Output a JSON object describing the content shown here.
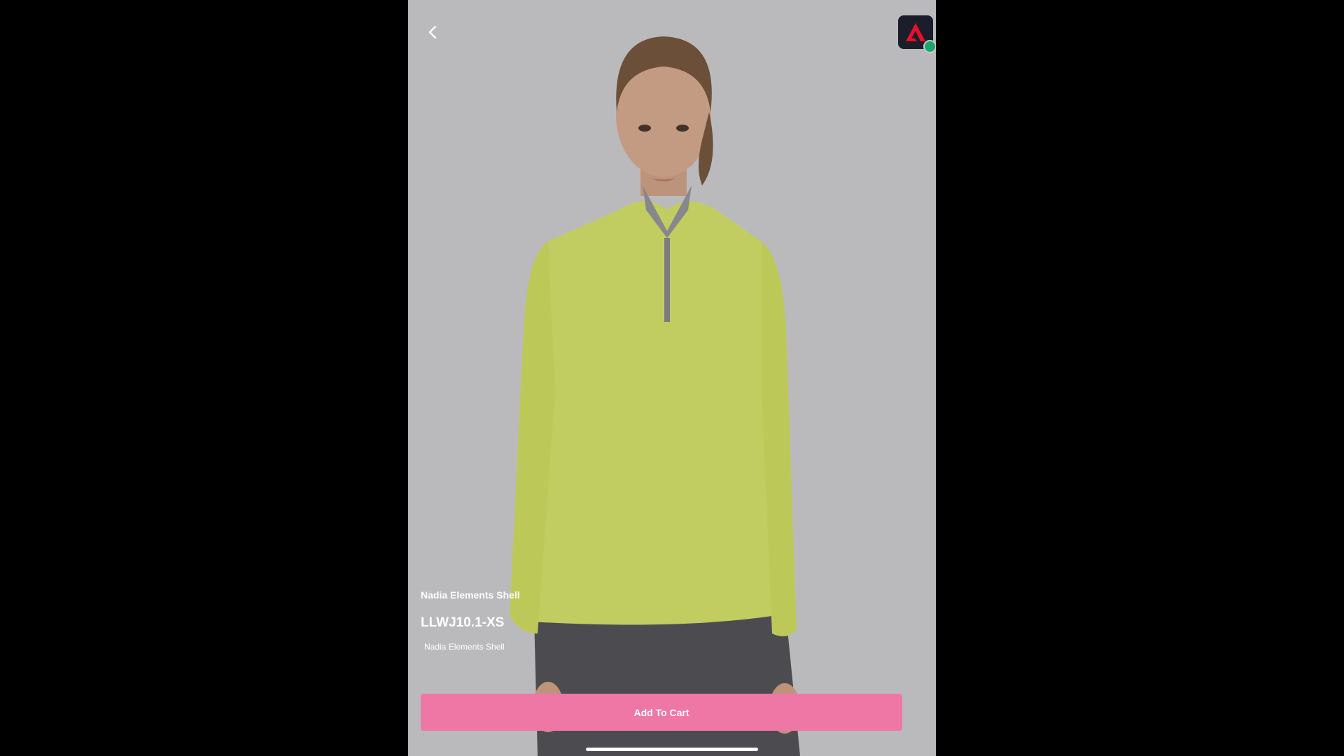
{
  "nav": {
    "back_icon": "chevron-left-icon"
  },
  "app_badge": {
    "icon": "adobe-logo-icon",
    "brand_color": "#e8102a",
    "status_color": "#1aa86a"
  },
  "product": {
    "title": "Nadia Elements Shell",
    "sku": "LLWJ10.1-XS",
    "description": "Nadia Elements Shell",
    "image_icon": "product-photo"
  },
  "actions": {
    "add_to_cart_label": "Add To Cart",
    "accent_color": "#ee77a6"
  }
}
